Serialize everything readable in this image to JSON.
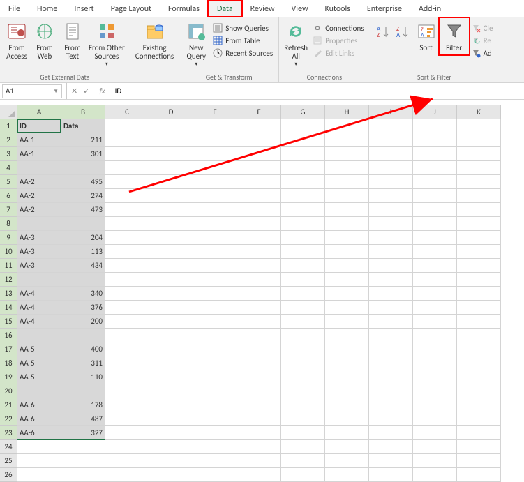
{
  "tabs": [
    "File",
    "Home",
    "Insert",
    "Page Layout",
    "Formulas",
    "Data",
    "Review",
    "View",
    "Kutools",
    "Enterprise",
    "Add-in"
  ],
  "active_tab": "Data",
  "ribbon": {
    "get_external": {
      "label": "Get External Data",
      "from_access": "From\nAccess",
      "from_web": "From\nWeb",
      "from_text": "From\nText",
      "from_other": "From Other\nSources"
    },
    "existing": "Existing\nConnections",
    "get_transform": {
      "label": "Get & Transform",
      "new_query": "New\nQuery",
      "show_queries": "Show Queries",
      "from_table": "From Table",
      "recent_sources": "Recent Sources"
    },
    "connections": {
      "label": "Connections",
      "refresh_all": "Refresh\nAll",
      "connections": "Connections",
      "properties": "Properties",
      "edit_links": "Edit Links"
    },
    "sort_filter": {
      "label": "Sort & Filter",
      "sort": "Sort",
      "filter": "Filter",
      "clear": "Cle",
      "reapply": "Re",
      "advanced": "Ad"
    }
  },
  "name_box": "A1",
  "formula_value": "ID",
  "columns": [
    "A",
    "B",
    "C",
    "D",
    "E",
    "F",
    "G",
    "H",
    "I",
    "J",
    "K"
  ],
  "rows": [
    {
      "n": 1,
      "a": "ID",
      "b": "Data",
      "hdr": true
    },
    {
      "n": 2,
      "a": "AA-1",
      "b": 211
    },
    {
      "n": 3,
      "a": "AA-1",
      "b": 301
    },
    {
      "n": 4,
      "a": "",
      "b": ""
    },
    {
      "n": 5,
      "a": "AA-2",
      "b": 495
    },
    {
      "n": 6,
      "a": "AA-2",
      "b": 274
    },
    {
      "n": 7,
      "a": "AA-2",
      "b": 473
    },
    {
      "n": 8,
      "a": "",
      "b": ""
    },
    {
      "n": 9,
      "a": "AA-3",
      "b": 204
    },
    {
      "n": 10,
      "a": "AA-3",
      "b": 113
    },
    {
      "n": 11,
      "a": "AA-3",
      "b": 434
    },
    {
      "n": 12,
      "a": "",
      "b": ""
    },
    {
      "n": 13,
      "a": "AA-4",
      "b": 340
    },
    {
      "n": 14,
      "a": "AA-4",
      "b": 376
    },
    {
      "n": 15,
      "a": "AA-4",
      "b": 200
    },
    {
      "n": 16,
      "a": "",
      "b": ""
    },
    {
      "n": 17,
      "a": "AA-5",
      "b": 400
    },
    {
      "n": 18,
      "a": "AA-5",
      "b": 311
    },
    {
      "n": 19,
      "a": "AA-5",
      "b": 110
    },
    {
      "n": 20,
      "a": "",
      "b": ""
    },
    {
      "n": 21,
      "a": "AA-6",
      "b": 178
    },
    {
      "n": 22,
      "a": "AA-6",
      "b": 487
    },
    {
      "n": 23,
      "a": "AA-6",
      "b": 327
    }
  ],
  "chart_data": {
    "type": "table",
    "title": "",
    "columns": [
      "ID",
      "Data"
    ],
    "rows": [
      [
        "AA-1",
        211
      ],
      [
        "AA-1",
        301
      ],
      [
        "",
        ""
      ],
      [
        "AA-2",
        495
      ],
      [
        "AA-2",
        274
      ],
      [
        "AA-2",
        473
      ],
      [
        "",
        ""
      ],
      [
        "AA-3",
        204
      ],
      [
        "AA-3",
        113
      ],
      [
        "AA-3",
        434
      ],
      [
        "",
        ""
      ],
      [
        "AA-4",
        340
      ],
      [
        "AA-4",
        376
      ],
      [
        "AA-4",
        200
      ],
      [
        "",
        ""
      ],
      [
        "AA-5",
        400
      ],
      [
        "AA-5",
        311
      ],
      [
        "AA-5",
        110
      ],
      [
        "",
        ""
      ],
      [
        "AA-6",
        178
      ],
      [
        "AA-6",
        487
      ],
      [
        "AA-6",
        327
      ]
    ]
  }
}
